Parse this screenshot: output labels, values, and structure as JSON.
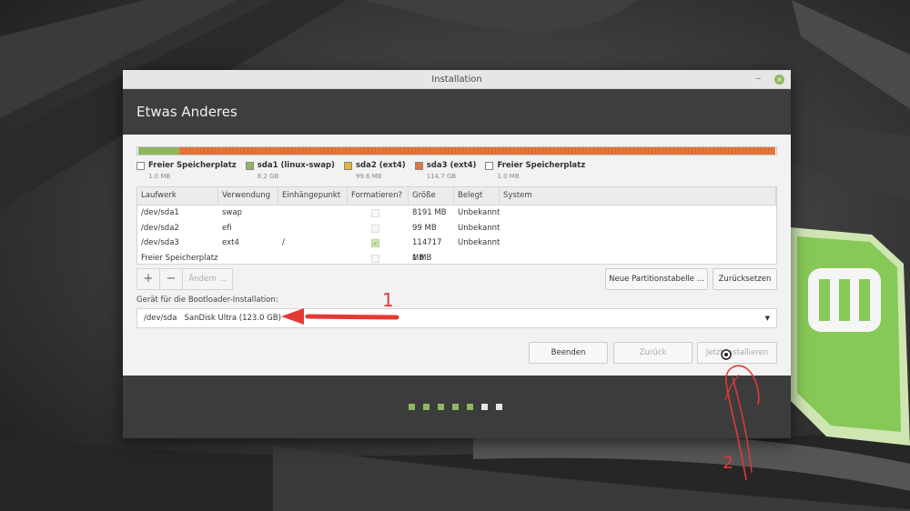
{
  "window": {
    "title": "Installation",
    "minimize_glyph": "‒",
    "close_glyph": "×"
  },
  "header": {
    "title": "Etwas Anderes"
  },
  "partition_bar": {
    "segments": [
      {
        "name": "Freier Speicherplatz",
        "fraction": 0.001,
        "color": "#ffffff"
      },
      {
        "name": "sda1 (linux-swap)",
        "fraction": 0.064,
        "color": "#8fb75e"
      },
      {
        "name": "sda2 (ext4)",
        "fraction": 0.001,
        "color": "#e2b93b"
      },
      {
        "name": "sda3 (ext4)",
        "fraction": 0.933,
        "color": "#e2783b"
      },
      {
        "name": "Freier Speicherplatz",
        "fraction": 0.001,
        "color": "#ffffff"
      }
    ]
  },
  "legend": [
    {
      "label": "Freier Speicherplatz",
      "size": "1.0 MB",
      "color": "#ffffff"
    },
    {
      "label": "sda1 (linux-swap)",
      "size": "8.2 GB",
      "color": "#8fb75e"
    },
    {
      "label": "sda2 (ext4)",
      "size": "99.6 MB",
      "color": "#e2b93b"
    },
    {
      "label": "sda3 (ext4)",
      "size": "114.7 GB",
      "color": "#e2783b"
    },
    {
      "label": "Freier Speicherplatz",
      "size": "1.0 MB",
      "color": "#ffffff"
    }
  ],
  "table": {
    "columns": [
      "Laufwerk",
      "Verwendung",
      "Einhängepunkt",
      "Formatieren?",
      "Größe",
      "Belegt",
      "System"
    ],
    "rows": [
      {
        "device": "/dev/sda1",
        "use": "swap",
        "mount": "",
        "format": false,
        "size": "8191 MB",
        "used": "Unbekannt",
        "system": ""
      },
      {
        "device": "/dev/sda2",
        "use": "efi",
        "mount": "",
        "format": false,
        "size": "99 MB",
        "used": "Unbekannt",
        "system": ""
      },
      {
        "device": "/dev/sda3",
        "use": "ext4",
        "mount": "/",
        "format": true,
        "size": "114717 MB",
        "used": "Unbekannt",
        "system": ""
      },
      {
        "device": "Freier Speicherplatz",
        "use": "",
        "mount": "",
        "format": false,
        "size": "1 MB",
        "used": "",
        "system": ""
      }
    ]
  },
  "table_buttons": {
    "add": "+",
    "remove": "−",
    "change": "Ändern ..."
  },
  "new_table_button": "Neue Partitionstabelle ...",
  "revert_button": "Zurücksetzen",
  "bootloader": {
    "label": "Gerät für die Bootloader-Installation:",
    "device": "/dev/sda",
    "model": "SanDisk Ultra (123.0 GB)"
  },
  "nav": {
    "quit": "Beenden",
    "back": "Zurück",
    "install": "Jetzt installieren"
  },
  "progress": {
    "total_steps": 7,
    "completed_steps": 5,
    "accent": "#8fb75e"
  },
  "annotations": {
    "arrow_label": "1",
    "scribble_label": "2",
    "color": "#e53935"
  }
}
